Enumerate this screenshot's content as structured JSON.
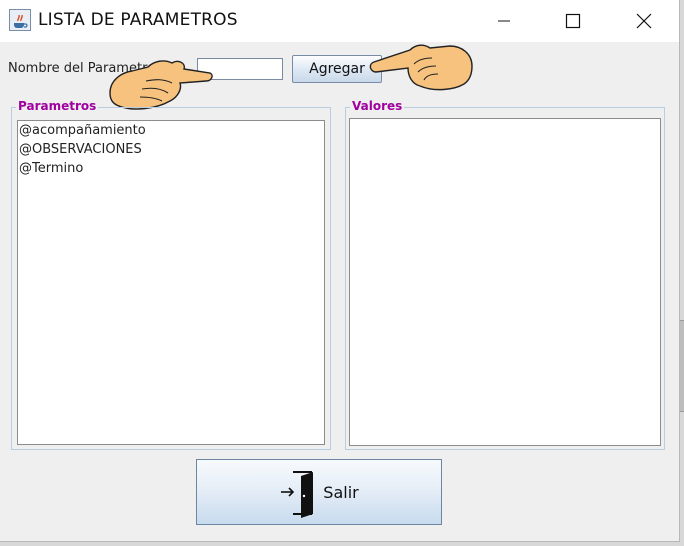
{
  "window": {
    "title": "LISTA DE PARAMETROS",
    "controls": {
      "minimize": "minimize-icon",
      "maximize": "maximize-icon",
      "close": "close-icon"
    }
  },
  "form": {
    "nombre_label": "Nombre del Parametro",
    "nombre_value": "",
    "agregar_label": "Agregar"
  },
  "parametros": {
    "title": "Parametros",
    "items": [
      "@acompañamiento",
      "@OBSERVACIONES",
      "@Termino"
    ]
  },
  "valores": {
    "title": "Valores",
    "items": []
  },
  "salir_label": "Salir",
  "colors": {
    "group_title": "#a000a0",
    "button_gradient_bottom": "#c7dbee",
    "hand_fill": "#f6c27e"
  },
  "icons": [
    "java-app-icon",
    "pointing-hand-icon",
    "exit-door-icon"
  ]
}
